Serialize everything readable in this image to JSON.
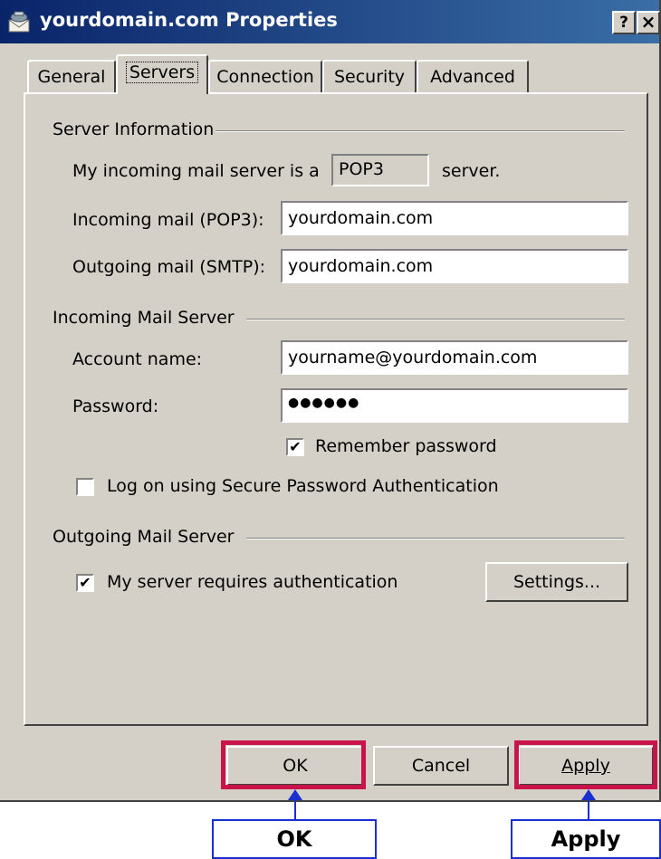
{
  "title_bar": {
    "title": "yourdomain.com Properties",
    "help_label": "?",
    "close_label": "×",
    "bg_color": "#0a246a"
  },
  "tabs": [
    {
      "label": "General",
      "selected": false
    },
    {
      "label": "Servers",
      "selected": true
    },
    {
      "label": "Connection",
      "selected": false
    },
    {
      "label": "Security",
      "selected": false
    },
    {
      "label": "Advanced",
      "selected": false
    }
  ],
  "server_info": {
    "group_label": "Server Information",
    "incoming_type_prefix": "My incoming mail server is a",
    "incoming_type_value": "POP3",
    "incoming_type_suffix": "server.",
    "incoming_label": "Incoming mail (POP3):",
    "incoming_value": "yourdomain.com",
    "outgoing_label": "Outgoing mail (SMTP):",
    "outgoing_value": "yourdomain.com"
  },
  "incoming_server": {
    "group_label": "Incoming Mail Server",
    "account_label": "Account name:",
    "account_value": "yourname@yourdomain.com",
    "password_label": "Password:",
    "password_value": "●●●●●●",
    "remember_label": "Remember password",
    "remember_checked": true,
    "spa_label": "Log on using Secure Password Authentication",
    "spa_checked": false
  },
  "outgoing_server": {
    "group_label": "Outgoing Mail Server",
    "auth_label": "My server requires authentication",
    "auth_checked": true,
    "settings_label": "Settings..."
  },
  "buttons": {
    "ok": "OK",
    "cancel": "Cancel",
    "apply": "Apply"
  },
  "callouts": {
    "ok": "OK",
    "apply": "Apply",
    "highlight_color": "#c8144a",
    "arrow_color": "#1a2fd0"
  },
  "colors": {
    "dialog_bg": "#d4d0c8"
  }
}
